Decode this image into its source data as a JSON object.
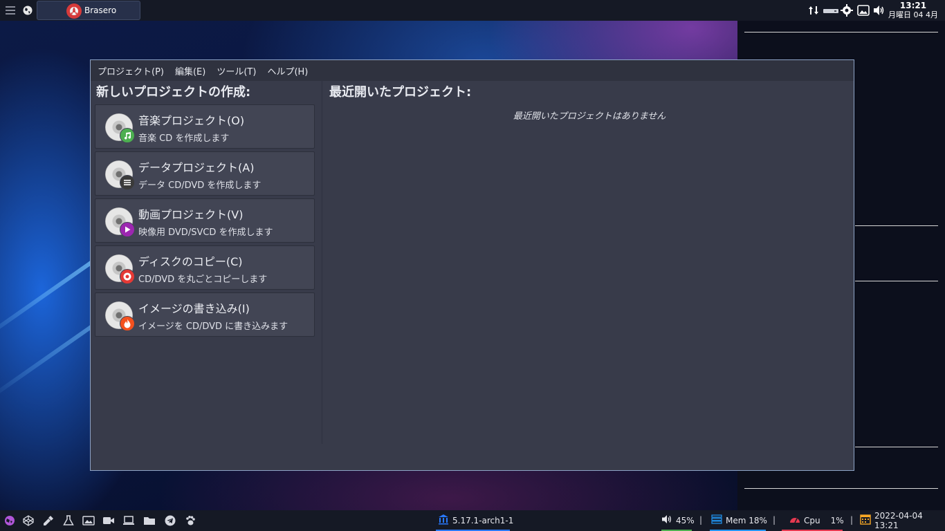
{
  "top_panel": {
    "task_label": "Brasero",
    "clock_time": "13:21",
    "clock_date": "月曜日 04 4月",
    "icons": [
      "menu-icon",
      "globe-icon",
      "network-transfer-icon",
      "drive-icon",
      "settings-gear-icon",
      "image-viewer-icon",
      "volume-icon"
    ]
  },
  "window": {
    "menu": [
      "プロジェクト(P)",
      "編集(E)",
      "ツール(T)",
      "ヘルプ(H)"
    ],
    "new_project_heading": "新しいプロジェクトの作成:",
    "recent_heading": "最近開いたプロジェクト:",
    "recent_empty": "最近開いたプロジェクトはありません",
    "projects": [
      {
        "title": "音楽プロジェクト(O)",
        "desc": "音楽 CD を作成します",
        "badge_icon": "music-note-icon",
        "badge_color": "#4caf50"
      },
      {
        "title": "データプロジェクト(A)",
        "desc": "データ CD/DVD を作成します",
        "badge_icon": "list-icon",
        "badge_color": "#3a3a3a"
      },
      {
        "title": "動画プロジェクト(V)",
        "desc": "映像用 DVD/SVCD を作成します",
        "badge_icon": "play-icon",
        "badge_color": "#9c27b0"
      },
      {
        "title": "ディスクのコピー(C)",
        "desc": "CD/DVD を丸ごとコピーします",
        "badge_icon": "disc-copy-icon",
        "badge_color": "#e53935"
      },
      {
        "title": "イメージの書き込み(I)",
        "desc": "イメージを CD/DVD に書き込みます",
        "badge_icon": "flame-icon",
        "badge_color": "#f4511e"
      }
    ]
  },
  "bottom_panel": {
    "launchers": [
      "app-menu-icon",
      "codepen-icon",
      "color-picker-icon",
      "flask-icon",
      "image-icon",
      "video-camera-icon",
      "laptop-icon",
      "folder-icon",
      "telegram-icon",
      "paw-icon"
    ],
    "kernel": "5.17.1-arch1-1",
    "volume": "45%",
    "mem": "Mem 18%",
    "cpu_label": "Cpu",
    "cpu_value": "1%",
    "datetime": "2022-04-04 13:21",
    "colors": {
      "kernel": "#2979ff",
      "volume": "#4caf50",
      "mem": "#2196f3",
      "cpu": "#e53950",
      "date": "#f9a825"
    }
  }
}
